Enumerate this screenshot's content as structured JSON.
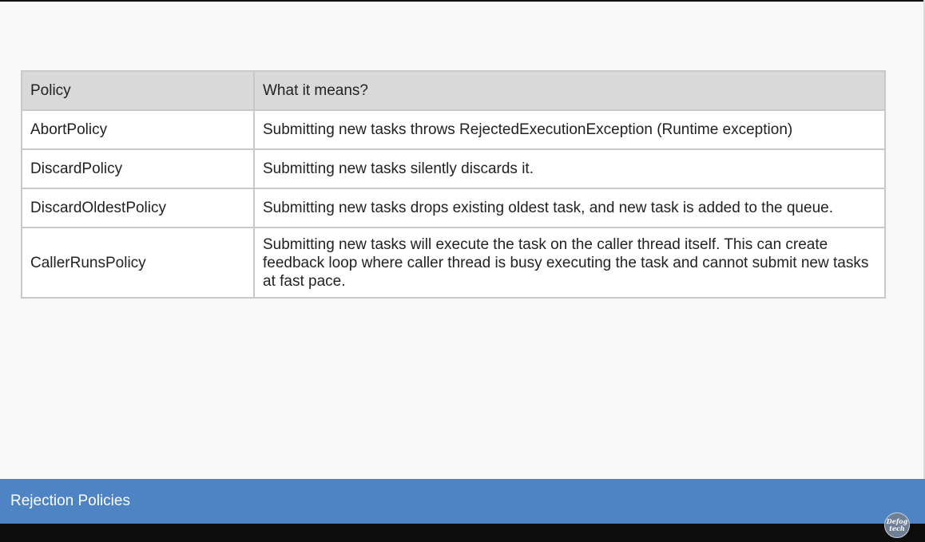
{
  "table": {
    "headers": {
      "policy": "Policy",
      "meaning": "What it means?"
    },
    "rows": [
      {
        "policy": "AbortPolicy",
        "meaning": "Submitting new tasks throws RejectedExecutionException (Runtime exception)"
      },
      {
        "policy": "DiscardPolicy",
        "meaning": "Submitting new tasks silently discards it."
      },
      {
        "policy": "DiscardOldestPolicy",
        "meaning": "Submitting new tasks drops existing oldest task, and new task is added to the queue."
      },
      {
        "policy": "CallerRunsPolicy",
        "meaning": "Submitting new tasks will execute the task on the caller thread itself. This can create feedback loop where caller thread is busy executing the task and cannot submit new tasks at fast pace."
      }
    ]
  },
  "footer": {
    "title": "Rejection Policies",
    "logo_line1": "Defog",
    "logo_line2": "tech"
  },
  "colors": {
    "footer_bar": "#4e83c4",
    "header_bg": "#d9d9d9",
    "border": "#c8c8c8",
    "page_bg": "#f8f8f8"
  }
}
